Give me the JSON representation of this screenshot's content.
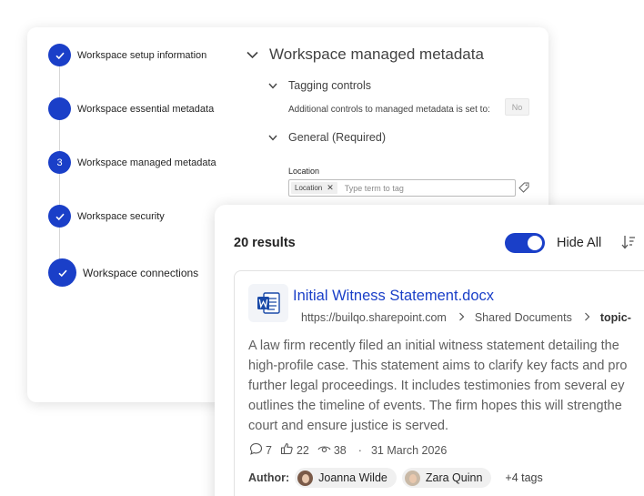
{
  "wizard": {
    "steps": [
      {
        "label": "Workspace setup information",
        "state": "done",
        "marker": ""
      },
      {
        "label": "Workspace essential metadata",
        "state": "in-progress",
        "marker": ""
      },
      {
        "label": "Workspace managed metadata",
        "state": "current",
        "marker": "3"
      },
      {
        "label": "Workspace security",
        "state": "done",
        "marker": ""
      },
      {
        "label": "Workspace connections",
        "state": "done",
        "marker": ""
      }
    ],
    "section_title": "Workspace managed metadata",
    "tagging_controls": {
      "heading": "Tagging controls",
      "text": "Additional controls to managed metadata is set to:",
      "value": "No"
    },
    "general": {
      "heading": "General (Required)",
      "location_label": "Location",
      "location_chip": "Location",
      "placeholder": "Type term to tag"
    }
  },
  "search": {
    "results_count": "20 results",
    "hide_all_label": "Hide All",
    "hide_all_on": true,
    "result": {
      "title": "Initial Witness Statement.docx",
      "breadcrumb": [
        "https://builqo.sharepoint.com",
        "Shared Documents",
        "topic-"
      ],
      "summary_lines": [
        "A law firm recently filed an initial witness statement detailing the",
        "high-profile case. This statement aims to clarify key facts and pro",
        "further legal proceedings. It includes testimonies from several ey",
        "outlines the timeline of events. The firm hopes this will strengthe",
        "court and ensure justice is served."
      ],
      "comments": "7",
      "likes": "22",
      "views": "38",
      "separator": "·",
      "date": "31 March 2026",
      "author_label": "Author:",
      "authors": [
        "Joanna Wilde",
        "Zara Quinn"
      ],
      "more_tags": "+4 tags"
    }
  },
  "colors": {
    "accent": "#1a3fc8",
    "link": "#1a3fc8",
    "text": "#242424",
    "muted": "#616161"
  },
  "icons": [
    "check-icon",
    "chevron-down-icon",
    "close-icon",
    "tag-icon",
    "sort-icon",
    "word-doc-icon",
    "chevron-right-icon",
    "comment-icon",
    "like-icon",
    "eye-icon"
  ]
}
